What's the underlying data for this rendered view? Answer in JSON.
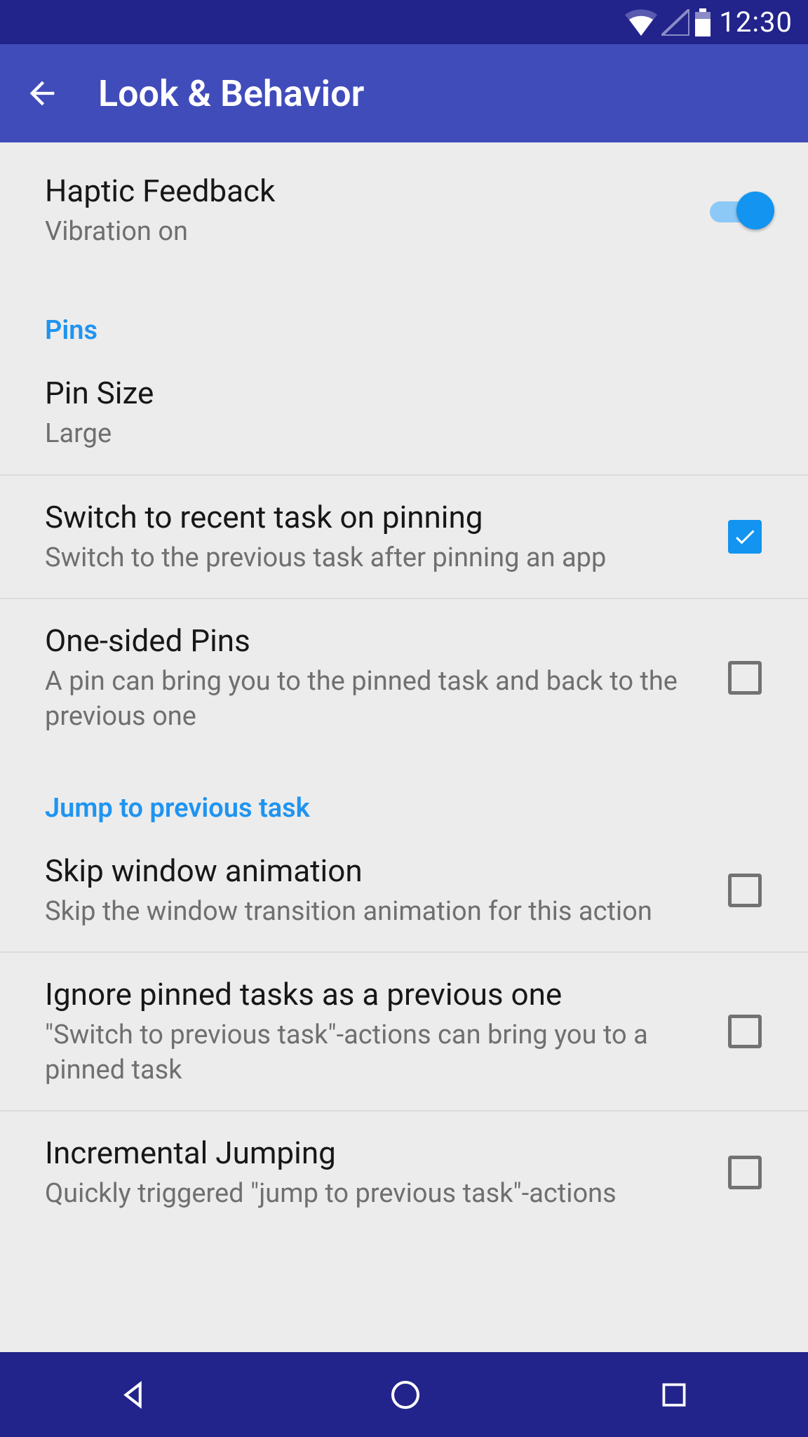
{
  "status": {
    "time": "12:30"
  },
  "appbar": {
    "title": "Look & Behavior"
  },
  "items": {
    "haptic": {
      "title": "Haptic Feedback",
      "sub": "Vibration on"
    },
    "pinsHeader": "Pins",
    "pinSize": {
      "title": "Pin Size",
      "sub": "Large"
    },
    "switchRecent": {
      "title": "Switch to recent task on pinning",
      "sub": "Switch to the previous task after pinning an app"
    },
    "oneSided": {
      "title": "One-sided Pins",
      "sub": "A pin can bring you to the pinned task and back to the previous one"
    },
    "jumpHeader": "Jump to previous task",
    "skipAnim": {
      "title": "Skip window animation",
      "sub": "Skip the window transition animation for this action"
    },
    "ignorePinned": {
      "title": "Ignore pinned tasks as a previous one",
      "sub": "\"Switch to previous task\"-actions can bring you to a pinned task"
    },
    "incJump": {
      "title": "Incremental Jumping",
      "sub": "Quickly triggered \"jump to previous task\"-actions"
    }
  }
}
